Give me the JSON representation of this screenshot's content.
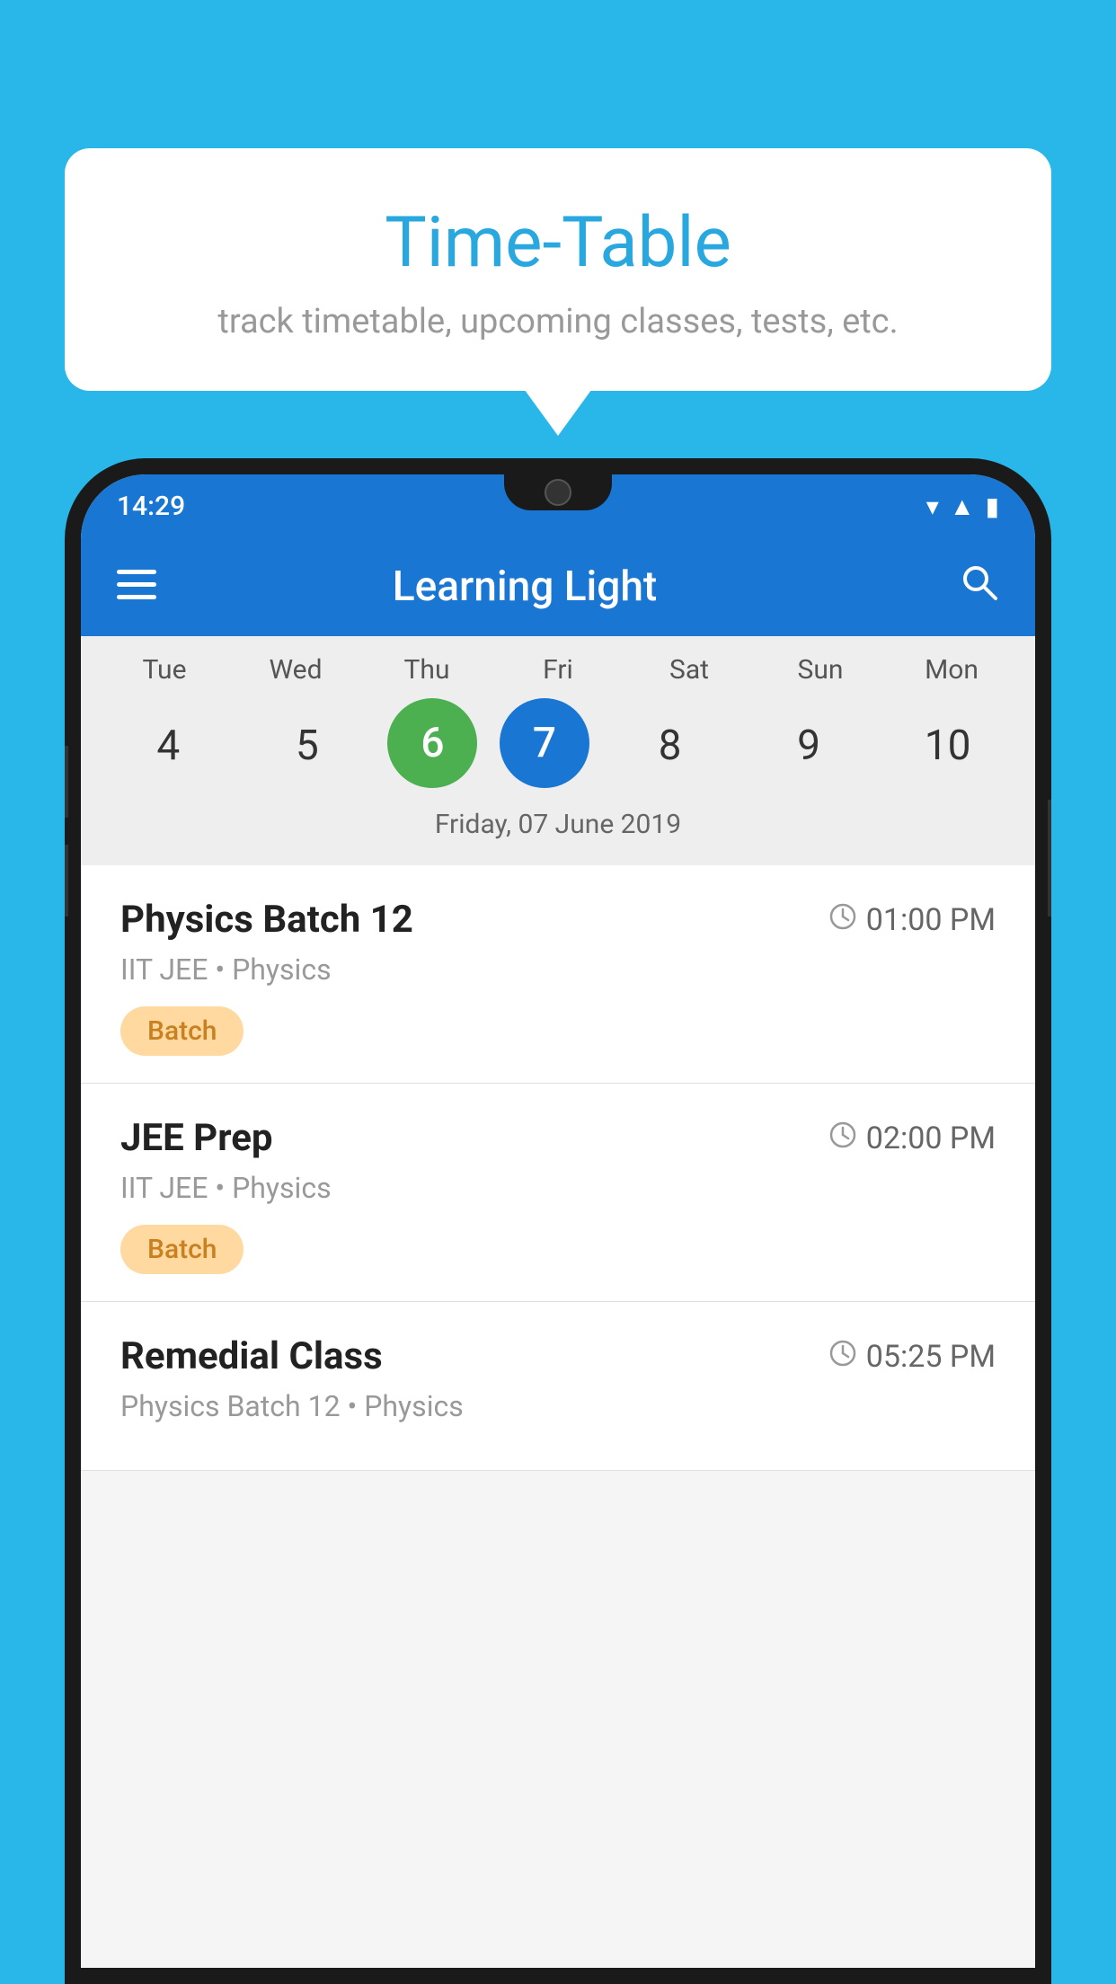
{
  "background_color": "#29b6e8",
  "tooltip": {
    "title": "Time-Table",
    "subtitle": "track timetable, upcoming classes, tests, etc."
  },
  "status_bar": {
    "time": "14:29"
  },
  "app_bar": {
    "title": "Learning Light"
  },
  "calendar": {
    "days": [
      {
        "label": "Tue",
        "number": "4"
      },
      {
        "label": "Wed",
        "number": "5"
      },
      {
        "label": "Thu",
        "number": "6",
        "state": "today"
      },
      {
        "label": "Fri",
        "number": "7",
        "state": "selected"
      },
      {
        "label": "Sat",
        "number": "8"
      },
      {
        "label": "Sun",
        "number": "9"
      },
      {
        "label": "Mon",
        "number": "10"
      }
    ],
    "selected_date": "Friday, 07 June 2019"
  },
  "schedule": [
    {
      "title": "Physics Batch 12",
      "time": "01:00 PM",
      "subtitle": "IIT JEE • Physics",
      "tag": "Batch"
    },
    {
      "title": "JEE Prep",
      "time": "02:00 PM",
      "subtitle": "IIT JEE • Physics",
      "tag": "Batch"
    },
    {
      "title": "Remedial Class",
      "time": "05:25 PM",
      "subtitle": "Physics Batch 12 • Physics",
      "tag": ""
    }
  ]
}
